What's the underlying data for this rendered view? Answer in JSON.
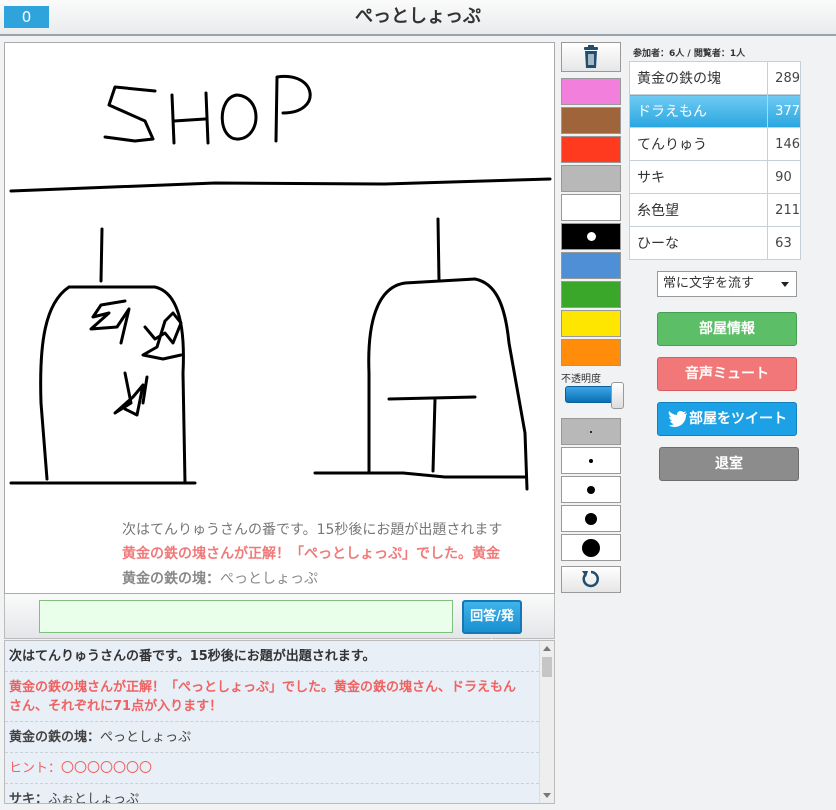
{
  "header": {
    "round_number": "0",
    "room_title": "ぺっとしょっぷ"
  },
  "canvas": {
    "overlay_messages": {
      "next_turn": "次はてんりゅうさんの番です。15秒後にお題が出題されます",
      "correct": "黄金の鉄の塊さんが正解！「ぺっとしょっぷ」でした。黄金",
      "last_answer_user": "黄金の鉄の塊：",
      "last_answer_text": "ぺっとしょっぷ"
    }
  },
  "input": {
    "value": "",
    "send_label": "回答/発言"
  },
  "chat": {
    "rows": [
      {
        "text": "次はてんりゅうさんの番です。15秒後にお題が出題されます。"
      },
      {
        "text": "黄金の鉄の塊さんが正解！「ぺっとしょっぷ」でした。黄金の鉄の塊さん、ドラえもんさん、それぞれに71点が入ります！"
      },
      {
        "user": "黄金の鉄の塊：",
        "text": "ぺっとしょっぷ"
      },
      {
        "text": "ヒント：〇〇〇〇〇〇〇"
      },
      {
        "user": "サキ：",
        "text": "ふぉとしょっぷ"
      }
    ]
  },
  "tools": {
    "colors": [
      "#f27fdc",
      "#a0643a",
      "#ff3a1f",
      "#b8b8b8",
      "#ffffff",
      "#000000",
      "#4f8fd6",
      "#3aa62a",
      "#ffe600",
      "#ff8c0a"
    ],
    "opacity_label": "不透明度",
    "opacity_value": 0.95,
    "brush_sizes": [
      2,
      4,
      8,
      12,
      18
    ],
    "trash_icon": "trash-icon",
    "undo_icon": "undo-icon"
  },
  "stats": {
    "text": "参加者：6人 / 閲覧者：1人"
  },
  "scoreboard": [
    {
      "name": "黄金の鉄の塊",
      "score": "289",
      "active": false
    },
    {
      "name": "ドラえもん",
      "score": "377",
      "active": true
    },
    {
      "name": "てんりゅう",
      "score": "146",
      "active": false
    },
    {
      "name": "サキ",
      "score": "90",
      "active": false
    },
    {
      "name": "糸色望",
      "score": "211",
      "active": false
    },
    {
      "name": "ひーな",
      "score": "63",
      "active": false
    }
  ],
  "controls": {
    "text_flow_selected": "常に文字を流す",
    "room_info_label": "部屋情報",
    "mute_label": "音声ミュート",
    "tweet_label": "部屋をツイート",
    "exit_label": "退室"
  }
}
